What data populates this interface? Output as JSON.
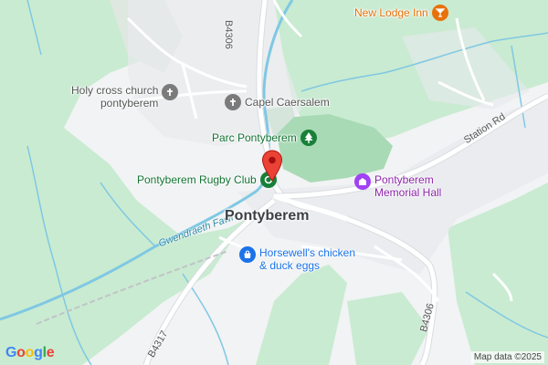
{
  "map": {
    "town_label": "Pontyberem",
    "attribution": "Map data ©2025",
    "logo": {
      "text": "Google",
      "letter_colors": [
        "#4285f4",
        "#ea4335",
        "#fbbc05",
        "#4285f4",
        "#34a853",
        "#ea4335"
      ]
    },
    "roads": {
      "b4306_north": "B4306",
      "b4306_south": "B4306",
      "b4317": "B4317",
      "station_rd": "Station Rd"
    },
    "river": "Gwendraeth Fawr",
    "pois": {
      "new_lodge_inn": {
        "label": "New Lodge Inn",
        "icon": "bar-icon",
        "color": "#e8710a"
      },
      "holy_cross_church": {
        "line1": "Holy cross church",
        "line2": "pontyberem",
        "icon": "church-cross-icon",
        "color": "#7b7b7b"
      },
      "capel_caersalem": {
        "label": "Capel Caersalem",
        "icon": "church-cross-icon",
        "color": "#7b7b7b"
      },
      "parc_pontyberem": {
        "label": "Parc Pontyberem",
        "icon": "park-tree-icon",
        "color": "#188038"
      },
      "rugby_club": {
        "label": "Pontyberem Rugby Club",
        "icon": "sports-icon",
        "color": "#188038"
      },
      "memorial_hall": {
        "line1": "Pontyberem",
        "line2": "Memorial Hall",
        "icon": "building-icon",
        "color": "#a142f4"
      },
      "horsewells": {
        "line1": "Horsewell's chicken",
        "line2": "& duck eggs",
        "icon": "shopping-bag-icon",
        "color": "#1a73e8"
      }
    },
    "colors": {
      "land": "#f1f3f4",
      "green_area": "#c9ebd1",
      "park": "#a8dab5",
      "road": "#ffffff",
      "water": "#7fc8e3",
      "pin": "#ea4335"
    }
  }
}
